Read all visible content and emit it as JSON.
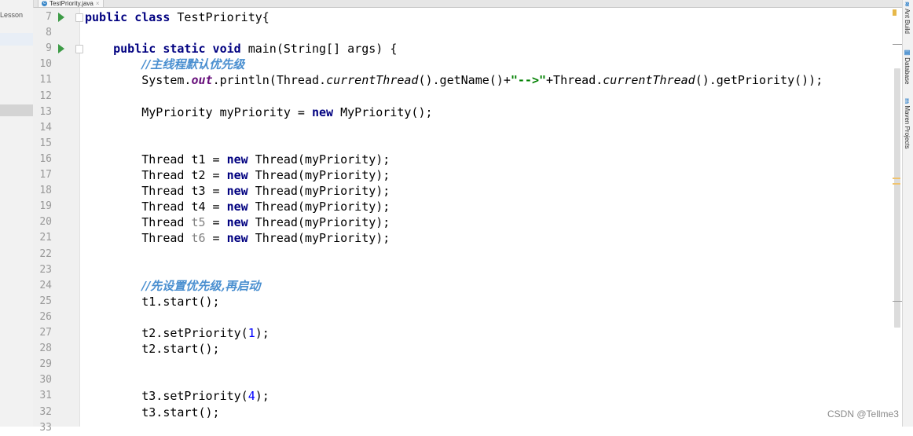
{
  "window": {
    "tab_label": "TestPriority.java",
    "tab_close": "×",
    "project_label": "Lesson",
    "toolbar_glyphs": "✲ · ⊩"
  },
  "editor": {
    "lines": [
      {
        "n": "7",
        "run": true,
        "fold": true,
        "tokens": [
          {
            "t": "public class ",
            "c": "kw"
          },
          {
            "t": "TestPriority{",
            "c": ""
          }
        ]
      },
      {
        "n": "8",
        "tokens": []
      },
      {
        "n": "9",
        "run": true,
        "fold": true,
        "tokens": [
          {
            "t": "    public static void ",
            "c": "kw"
          },
          {
            "t": "main(String[] args) {",
            "c": ""
          }
        ]
      },
      {
        "n": "10",
        "tokens": [
          {
            "t": "        ",
            "c": ""
          },
          {
            "t": "//主线程默认优先级",
            "c": "cm"
          }
        ]
      },
      {
        "n": "11",
        "tokens": [
          {
            "t": "        System.",
            "c": ""
          },
          {
            "t": "out",
            "c": "stf"
          },
          {
            "t": ".println(Thread.",
            "c": ""
          },
          {
            "t": "currentThread",
            "c": "it"
          },
          {
            "t": "().getName()+",
            "c": ""
          },
          {
            "t": "\"-->\"",
            "c": "str"
          },
          {
            "t": "+Thread.",
            "c": ""
          },
          {
            "t": "currentThread",
            "c": "it"
          },
          {
            "t": "().getPriority());",
            "c": ""
          }
        ]
      },
      {
        "n": "12",
        "tokens": []
      },
      {
        "n": "13",
        "tokens": [
          {
            "t": "        MyPriority myPriority = ",
            "c": ""
          },
          {
            "t": "new",
            "c": "kw"
          },
          {
            "t": " MyPriority();",
            "c": ""
          }
        ]
      },
      {
        "n": "14",
        "tokens": []
      },
      {
        "n": "15",
        "tokens": []
      },
      {
        "n": "16",
        "tokens": [
          {
            "t": "        Thread t1 = ",
            "c": ""
          },
          {
            "t": "new",
            "c": "kw"
          },
          {
            "t": " Thread(myPriority);",
            "c": ""
          }
        ]
      },
      {
        "n": "17",
        "tokens": [
          {
            "t": "        Thread t2 = ",
            "c": ""
          },
          {
            "t": "new",
            "c": "kw"
          },
          {
            "t": " Thread(myPriority);",
            "c": ""
          }
        ]
      },
      {
        "n": "18",
        "tokens": [
          {
            "t": "        Thread t3 = ",
            "c": ""
          },
          {
            "t": "new",
            "c": "kw"
          },
          {
            "t": " Thread(myPriority);",
            "c": ""
          }
        ]
      },
      {
        "n": "19",
        "tokens": [
          {
            "t": "        Thread t4 = ",
            "c": ""
          },
          {
            "t": "new",
            "c": "kw"
          },
          {
            "t": " Thread(myPriority);",
            "c": ""
          }
        ]
      },
      {
        "n": "20",
        "tokens": [
          {
            "t": "        Thread ",
            "c": ""
          },
          {
            "t": "t5",
            "c": "unused"
          },
          {
            "t": " = ",
            "c": ""
          },
          {
            "t": "new",
            "c": "kw"
          },
          {
            "t": " Thread(myPriority);",
            "c": ""
          }
        ]
      },
      {
        "n": "21",
        "tokens": [
          {
            "t": "        Thread ",
            "c": ""
          },
          {
            "t": "t6",
            "c": "unused"
          },
          {
            "t": " = ",
            "c": ""
          },
          {
            "t": "new",
            "c": "kw"
          },
          {
            "t": " Thread(myPriority);",
            "c": ""
          }
        ]
      },
      {
        "n": "22",
        "tokens": []
      },
      {
        "n": "23",
        "tokens": []
      },
      {
        "n": "24",
        "tokens": [
          {
            "t": "        ",
            "c": ""
          },
          {
            "t": "//先设置优先级,再启动",
            "c": "cm"
          }
        ]
      },
      {
        "n": "25",
        "tokens": [
          {
            "t": "        t1.start();",
            "c": ""
          }
        ]
      },
      {
        "n": "26",
        "tokens": []
      },
      {
        "n": "27",
        "tokens": [
          {
            "t": "        t2.setPriority(",
            "c": ""
          },
          {
            "t": "1",
            "c": "num"
          },
          {
            "t": ");",
            "c": ""
          }
        ]
      },
      {
        "n": "28",
        "tokens": [
          {
            "t": "        t2.start();",
            "c": ""
          }
        ]
      },
      {
        "n": "29",
        "tokens": []
      },
      {
        "n": "30",
        "tokens": []
      },
      {
        "n": "31",
        "tokens": [
          {
            "t": "        t3.setPriority(",
            "c": ""
          },
          {
            "t": "4",
            "c": "num"
          },
          {
            "t": ");",
            "c": ""
          }
        ]
      },
      {
        "n": "32",
        "tokens": [
          {
            "t": "        t3.start();",
            "c": ""
          }
        ]
      },
      {
        "n": "33",
        "tokens": []
      }
    ]
  },
  "right_tools": [
    {
      "icon": "≋",
      "label": "Ant Build"
    },
    {
      "icon": "▤",
      "label": "Database"
    },
    {
      "icon": "m",
      "label": "Maven Projects"
    }
  ],
  "watermark": "CSDN @Tellme3"
}
